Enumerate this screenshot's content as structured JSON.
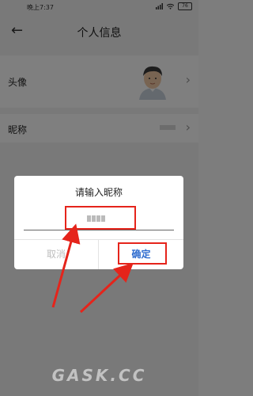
{
  "status_bar": {
    "time": "晚上7:37",
    "battery": "76"
  },
  "header": {
    "title": "个人信息",
    "back_icon": "arrow-left-icon"
  },
  "rows": [
    {
      "label": "头像",
      "icon": "chevron-right-icon"
    },
    {
      "label": "昵称",
      "icon": "chevron-right-icon"
    }
  ],
  "dialog": {
    "title": "请输入昵称",
    "cancel_label": "取消",
    "ok_label": "确定"
  },
  "watermark": "GASK.CC",
  "colors": {
    "highlight": "#e5241b",
    "accent": "#2e6ccf"
  }
}
